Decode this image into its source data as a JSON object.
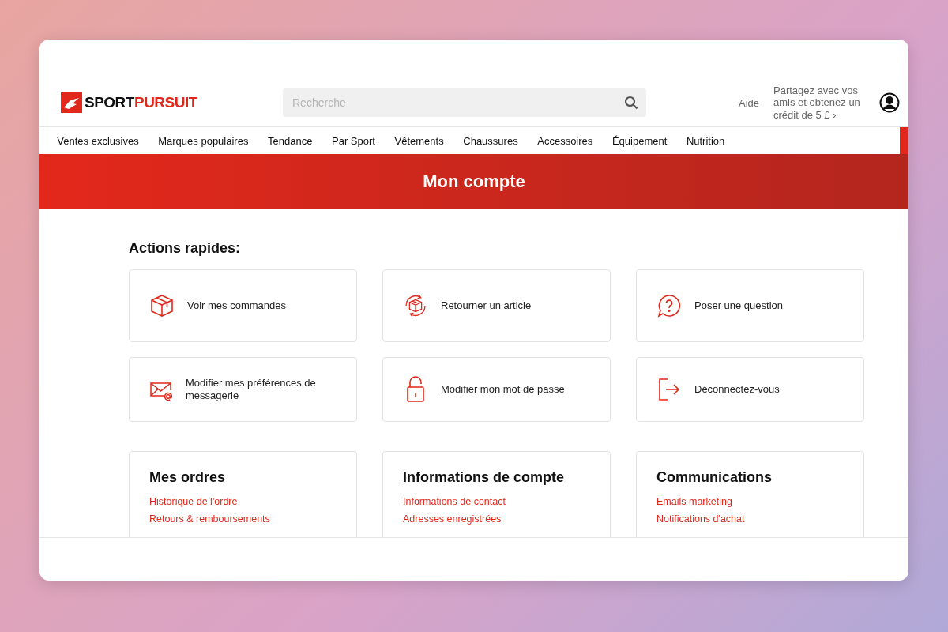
{
  "logo": {
    "first": "SPORT",
    "second": "PURSUIT"
  },
  "search": {
    "placeholder": "Recherche"
  },
  "header_links": {
    "help": "Aide",
    "referral": "Partagez avec vos amis et obtenez un crédit de 5 £ ›"
  },
  "nav": [
    "Ventes exclusives",
    "Marques populaires",
    "Tendance",
    "Par Sport",
    "Vêtements",
    "Chaussures",
    "Accessoires",
    "Équipement",
    "Nutrition"
  ],
  "banner": {
    "title": "Mon compte"
  },
  "quick_actions": {
    "title": "Actions rapides:",
    "items": [
      {
        "kind": "box",
        "label": "Voir mes commandes"
      },
      {
        "kind": "return",
        "label": "Retourner un article"
      },
      {
        "kind": "question",
        "label": "Poser une question"
      },
      {
        "kind": "mail",
        "label": "Modifier mes préférences de messagerie"
      },
      {
        "kind": "lock",
        "label": "Modifier mon mot de passe"
      },
      {
        "kind": "logout",
        "label": "Déconnectez-vous"
      }
    ]
  },
  "sections": [
    {
      "title": "Mes ordres",
      "links": [
        "Historique de l'ordre",
        "Retours & remboursements"
      ]
    },
    {
      "title": "Informations de compte",
      "links": [
        "Informations de contact",
        "Adresses enregistrées"
      ]
    },
    {
      "title": "Communications",
      "links": [
        "Emails marketing",
        "Notifications d'achat"
      ]
    }
  ]
}
